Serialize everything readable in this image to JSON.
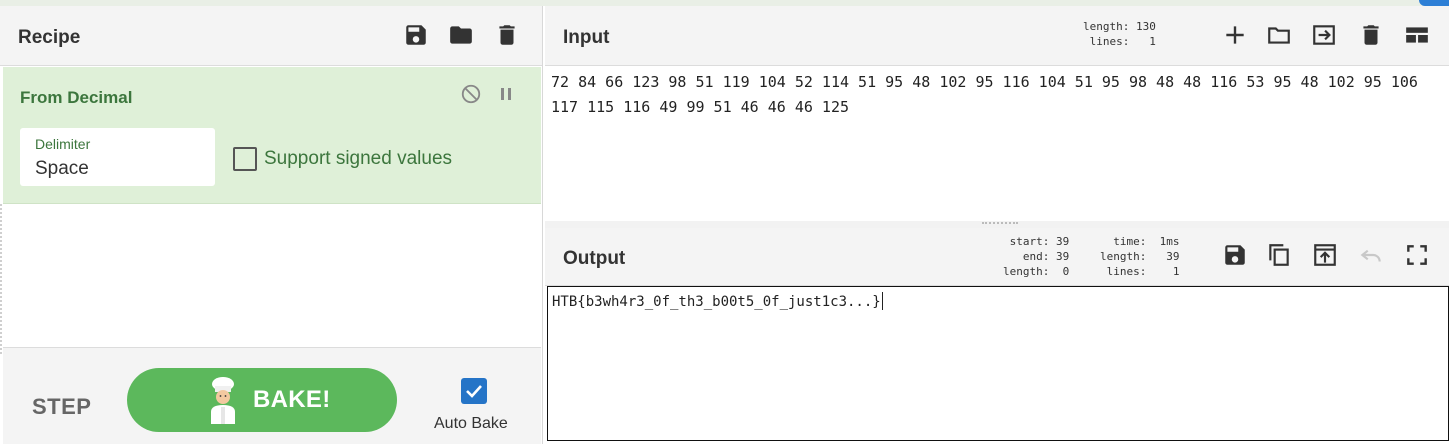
{
  "recipe": {
    "title": "Recipe",
    "icons": [
      "save-icon",
      "folder-icon",
      "trash-icon"
    ],
    "operation": {
      "title": "From Decimal",
      "delimiter_label": "Delimiter",
      "delimiter_value": "Space",
      "signed_label": "Support signed values",
      "signed_checked": false
    },
    "controls": {
      "step_label": "STEP",
      "bake_label": "BAKE!",
      "autobake_label": "Auto Bake",
      "autobake_checked": true
    }
  },
  "input": {
    "title": "Input",
    "stats": "length: 130\n lines:   1",
    "text": "72 84 66 123 98 51 119 104 52 114 51 95 48 102 95 116 104 51 95 98 48 48 116 53 95 48 102 95 106 117 115 116 49 99 51 46 46 46 125",
    "icons": [
      "plus-icon",
      "folder-icon",
      "input-file-icon",
      "trash-icon",
      "layout-icon"
    ]
  },
  "output": {
    "title": "Output",
    "stats_left": "start: 39\n  end: 39\nlength:  0",
    "stats_right": "  time:  1ms\nlength:   39\n lines:    1",
    "text": "HTB{b3wh4r3_0f_th3_b00t5_0f_just1c3...}",
    "icons": [
      "save-icon",
      "copy-icon",
      "replace-input-icon",
      "undo-icon",
      "fullscreen-icon"
    ]
  },
  "colors": {
    "accent_green": "#5cb85c",
    "op_background": "#dff0d8",
    "op_text": "#3c763d",
    "autobake_blue": "#2574c7"
  }
}
